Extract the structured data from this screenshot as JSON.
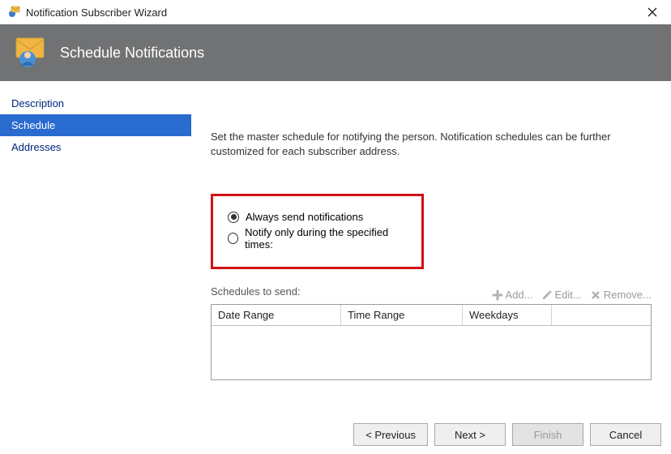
{
  "window": {
    "title": "Notification Subscriber Wizard"
  },
  "banner": {
    "title": "Schedule Notifications"
  },
  "sidebar": {
    "items": [
      {
        "label": "Description",
        "selected": false
      },
      {
        "label": "Schedule",
        "selected": true
      },
      {
        "label": "Addresses",
        "selected": false
      }
    ]
  },
  "main": {
    "intro": "Set the master schedule for notifying the person. Notification schedules can be further customized for each subscriber address.",
    "option_always": "Always send notifications",
    "option_specified": "Notify only during the specified times:",
    "selected_option": "always",
    "schedules_label": "Schedules to send:",
    "toolbar": {
      "add": "Add...",
      "edit": "Edit...",
      "remove": "Remove..."
    },
    "columns": {
      "date_range": "Date Range",
      "time_range": "Time Range",
      "weekdays": "Weekdays"
    }
  },
  "footer": {
    "previous": "< Previous",
    "next": "Next >",
    "finish": "Finish",
    "cancel": "Cancel"
  }
}
